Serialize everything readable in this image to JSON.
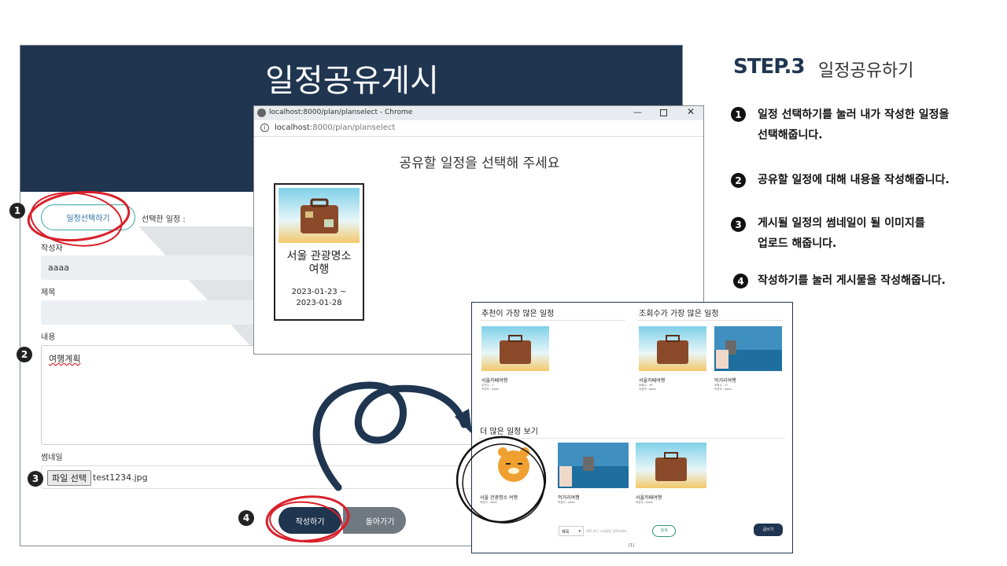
{
  "form": {
    "title": "일정공유게시",
    "select_plan_button": "일정선택하기",
    "selected_plan_label": "선택한 일정 :",
    "author_label": "작성자",
    "author_value": "aaaa",
    "subject_label": "제목",
    "content_label": "내용",
    "content_value": "여행계획",
    "thumbnail_label": "썸네일",
    "file_button": "파일 선택",
    "file_name": "test1234.jpg",
    "submit_button": "작성하기",
    "back_button": "돌아가기"
  },
  "popup": {
    "window_title": "localhost:8000/plan/planselect - Chrome",
    "url_host": "localhost",
    "url_rest": ":8000/plan/planselect",
    "heading": "공유할 일정을 선택해 주세요",
    "card_title": "서울 관광명소 여행",
    "card_dates": "2023-01-23 ~ 2023-01-28"
  },
  "preview": {
    "most_liked_title": "추천이 가장 많은 일정",
    "most_viewed_title": "조회수가 가장 많은 일정",
    "more_title": "더 많은 일정 보기",
    "liked_item": {
      "title": "서울카페여행",
      "meta1": "추천수 : 1",
      "meta2": "작성자 : aaaa"
    },
    "viewed_items": [
      {
        "title": "서울카페여행",
        "meta1": "조회수 : 49",
        "meta2": "작성자 : aaaa"
      },
      {
        "title": "먹거리여행",
        "meta1": "조회수 : 27",
        "meta2": "작성자 : aaaa"
      }
    ],
    "more_items": [
      {
        "title": "서울 관광명소 여행",
        "meta": "작성자 : aaaa"
      },
      {
        "title": "먹거리여행",
        "meta": "작성자 : aaaa"
      },
      {
        "title": "서울카페여행",
        "meta": "작성자 : aaaa"
      }
    ],
    "search_select": "제목",
    "search_placeholder": "제목 또는 닉네임을 입력하세요",
    "search_button": "검색",
    "write_button": "글쓰기",
    "pagination": "[1]"
  },
  "instructions": {
    "step_label": "STEP.3",
    "step_title": "일정공유하기",
    "items": [
      {
        "num": "1",
        "line1": "일정 선택하기를 눌러 내가 작성한 일정을",
        "line2": "선택해줍니다."
      },
      {
        "num": "2",
        "line1": "공유할 일정에 대해 내용을 작성해줍니다.",
        "line2": ""
      },
      {
        "num": "3",
        "line1": "게시될 일정의 썸네일이 될 이미지를",
        "line2": "업로드 해줍니다."
      },
      {
        "num": "4",
        "line1": "작성하기를 눌러 게시물을 작성해줍니다.",
        "line2": ""
      }
    ]
  },
  "badges": [
    "1",
    "2",
    "3",
    "4"
  ],
  "colors": {
    "navy": "#1f3550",
    "annotation_red": "#d9202a",
    "teal": "#3aa6a6"
  }
}
